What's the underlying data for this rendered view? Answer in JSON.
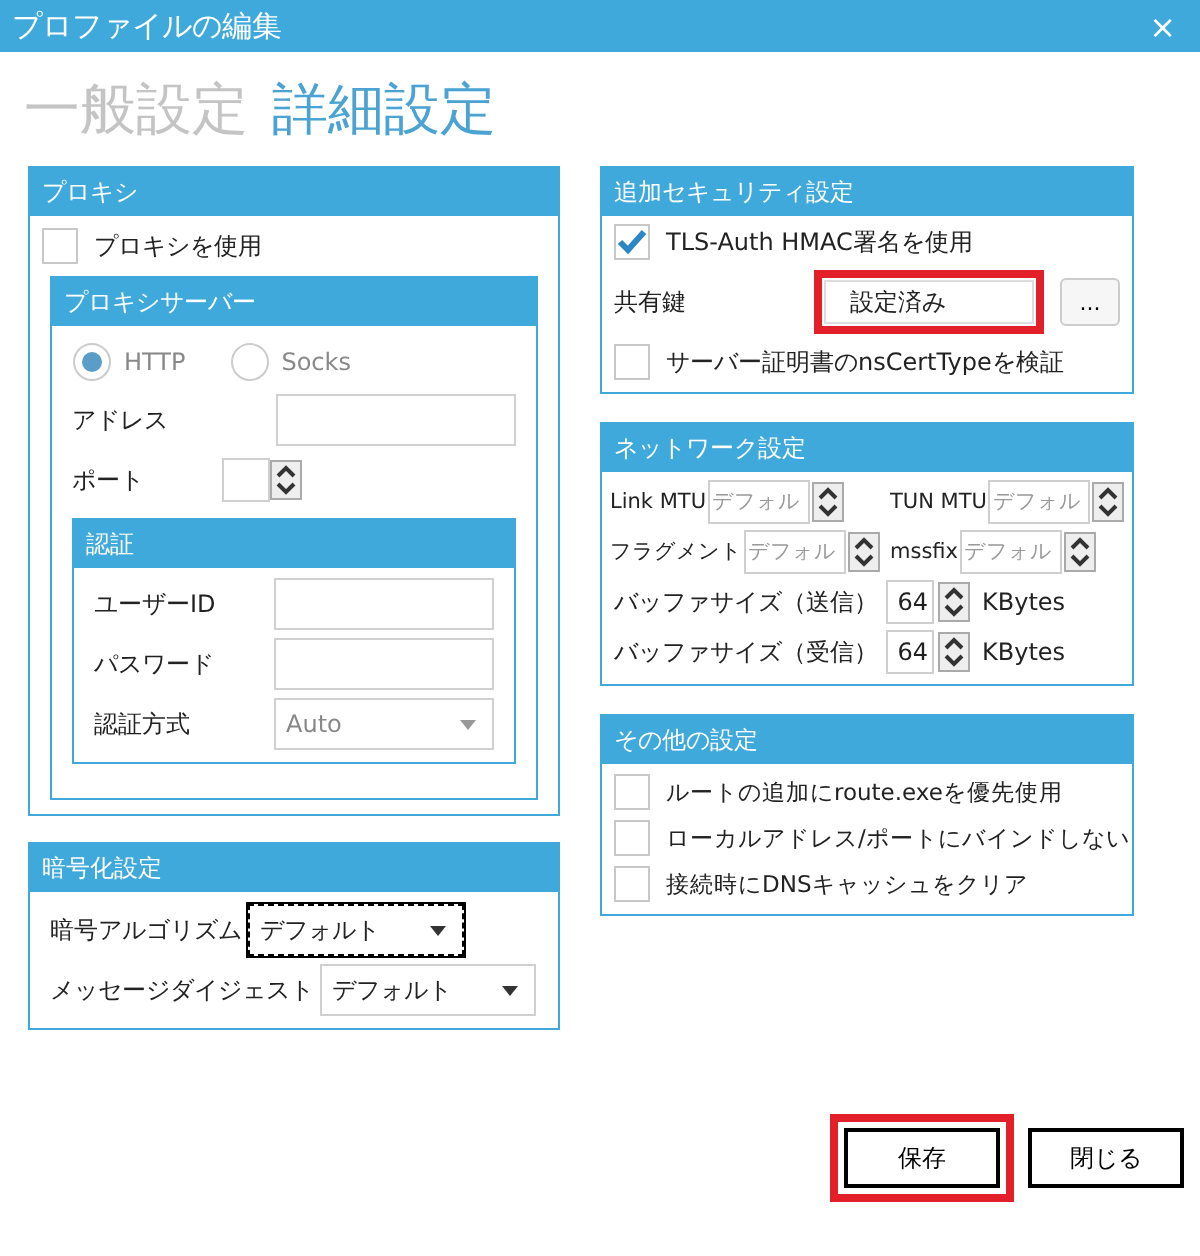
{
  "window": {
    "title": "プロファイルの編集",
    "close": "×"
  },
  "tabs": [
    {
      "label": "一般設定",
      "selected": false
    },
    {
      "label": "詳細設定",
      "selected": true
    }
  ],
  "proxy": {
    "title": "プロキシ",
    "use_proxy": {
      "label": "プロキシを使用",
      "checked": false
    },
    "server": {
      "title": "プロキシサーバー",
      "types": [
        {
          "label": "HTTP",
          "selected": true
        },
        {
          "label": "Socks",
          "selected": false
        }
      ],
      "address_label": "アドレス",
      "port_label": "ポート",
      "auth": {
        "title": "認証",
        "user_label": "ユーザーID",
        "password_label": "パスワード",
        "method_label": "認証方式",
        "method_value": "Auto"
      }
    }
  },
  "encryption": {
    "title": "暗号化設定",
    "fields": [
      {
        "label": "暗号アルゴリズム",
        "value": "デフォルト",
        "focused": true
      },
      {
        "label": "メッセージダイジェスト",
        "value": "デフォルト",
        "focused": false
      }
    ]
  },
  "security": {
    "title": "追加セキュリティ設定",
    "tls_auth": {
      "label": "TLS-Auth HMAC署名を使用",
      "checked": true
    },
    "shared_key": {
      "label": "共有鍵",
      "value": "設定済み",
      "button": "...",
      "highlighted": true
    },
    "ns_cert": {
      "label": "サーバー証明書のnsCertTypeを検証",
      "checked": false
    }
  },
  "network": {
    "title": "ネットワーク設定",
    "spinners": [
      {
        "label": "Link MTU",
        "placeholder": "デフォル"
      },
      {
        "label": "TUN MTU",
        "placeholder": "デフォル"
      },
      {
        "label": "フラグメント",
        "placeholder": "デフォル"
      },
      {
        "label": "mssfix",
        "placeholder": "デフォル"
      }
    ],
    "buffers": [
      {
        "label": "バッファサイズ（送信）",
        "value": "64",
        "unit": "KBytes"
      },
      {
        "label": "バッファサイズ（受信）",
        "value": "64",
        "unit": "KBytes"
      }
    ]
  },
  "other": {
    "title": "その他の設定",
    "options": [
      {
        "label": "ルートの追加にroute.exeを優先使用",
        "checked": false
      },
      {
        "label": "ローカルアドレス/ポートにバインドしない",
        "checked": false
      },
      {
        "label": "接続時にDNSキャッシュをクリア",
        "checked": false
      }
    ]
  },
  "buttons": [
    {
      "label": "保存",
      "highlighted": true
    },
    {
      "label": "閉じる",
      "highlighted": false
    }
  ]
}
